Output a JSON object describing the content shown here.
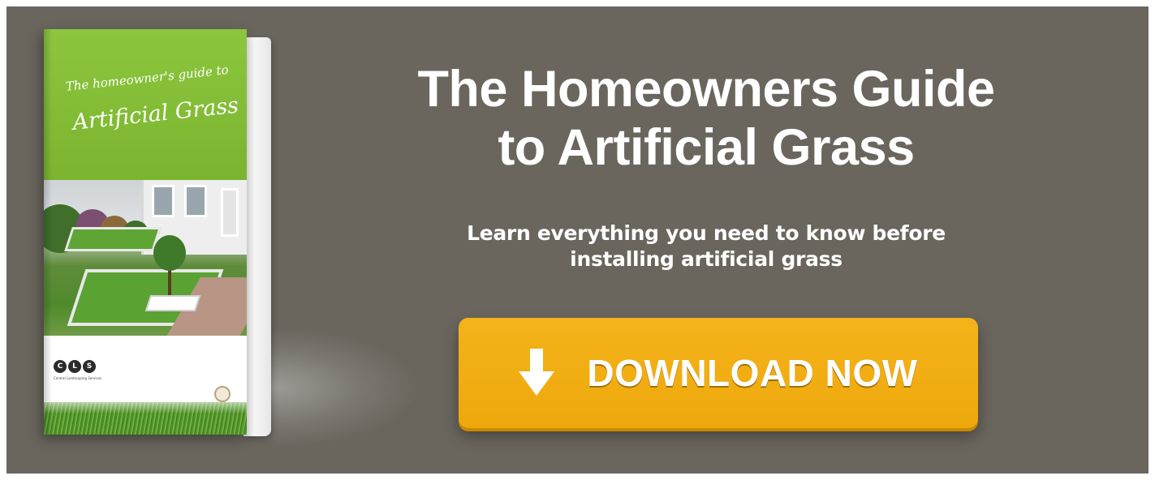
{
  "book": {
    "cover_line1": "The homeowner's guide to",
    "cover_line2": "Artificial Grass",
    "logo_letters": [
      "C",
      "L",
      "S"
    ],
    "logo_caption": "Central Landscaping Services"
  },
  "headline": {
    "line1": "The Homeowners Guide",
    "line2": "to Artificial Grass"
  },
  "subline": {
    "line1": "Learn everything you need to know before",
    "line2": "installing artificial grass"
  },
  "cta": {
    "label": "DOWNLOAD NOW",
    "icon": "arrow-down-icon"
  },
  "colors": {
    "background": "#6a665e",
    "accent": "#f0aa10",
    "cover_green": "#8cc63f",
    "text": "#ffffff"
  }
}
